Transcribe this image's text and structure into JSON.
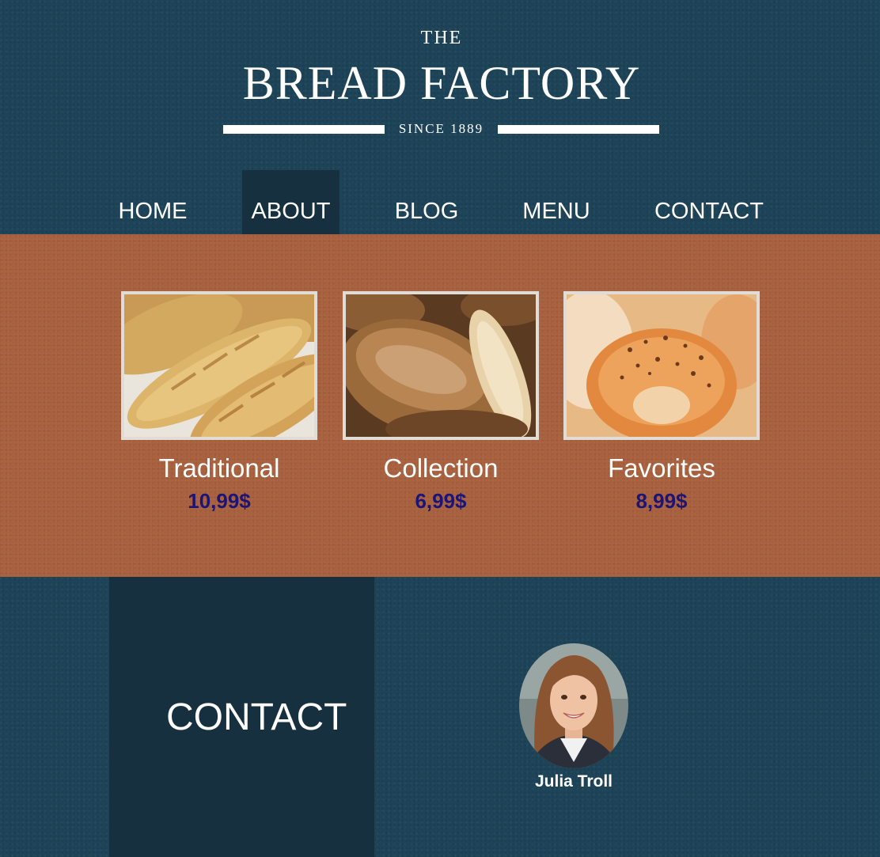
{
  "brand": {
    "the": "THE",
    "name": "BREAD FACTORY",
    "since": "SINCE 1889"
  },
  "nav": {
    "items": [
      {
        "label": "HOME",
        "active": false
      },
      {
        "label": "ABOUT",
        "active": true
      },
      {
        "label": "BLOG",
        "active": false
      },
      {
        "label": "MENU",
        "active": false
      },
      {
        "label": "CONTACT",
        "active": false
      }
    ]
  },
  "products": [
    {
      "title": "Traditional",
      "price": "10,99$",
      "image": "baguettes-photo"
    },
    {
      "title": "Collection",
      "price": "6,99$",
      "image": "rustic-loaves-photo"
    },
    {
      "title": "Favorites",
      "price": "8,99$",
      "image": "bagels-photo"
    }
  ],
  "contact": {
    "heading": "CONTACT",
    "person_name": "Julia Troll"
  },
  "colors": {
    "header_bg": "#1e4459",
    "nav_active_bg": "#17303f",
    "products_bg": "#a8603d",
    "price_text": "#1d1477",
    "photo_border": "#e2dcd7"
  }
}
